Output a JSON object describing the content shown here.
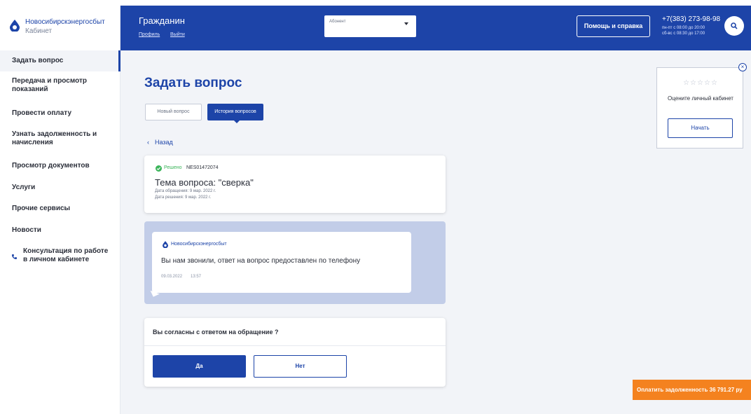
{
  "brand": {
    "name": "Новосибирскэнергосбыт",
    "subtitle": "Кабинет"
  },
  "sidebar": {
    "items": [
      {
        "label": "Задать вопрос",
        "active": true
      },
      {
        "label": "Передача и просмотр показаний"
      },
      {
        "label": "Провести оплату"
      },
      {
        "label": "Узнать задолженность и начисления"
      },
      {
        "label": "Просмотр документов"
      },
      {
        "label": "Услуги"
      },
      {
        "label": "Прочие сервисы"
      },
      {
        "label": "Новости"
      },
      {
        "label": "Консультация по работе в личном кабинете",
        "icon": "phone-icon"
      }
    ]
  },
  "header": {
    "title": "Гражданин",
    "profile_link": "Профиль",
    "logout_link": "Выйти",
    "account_select_label": "Абонент",
    "help_button": "Помощь и справка",
    "phone": "+7(383) 273-98-98",
    "hours_weekdays": "пн-пт с 08:00 до 20:00",
    "hours_weekend": "сб-вс с 08:30 до 17:00",
    "search_icon": "search-icon"
  },
  "main": {
    "page_title": "Задать вопрос",
    "tabs": [
      {
        "label": "Новый вопрос",
        "active": false
      },
      {
        "label": "История вопросов",
        "active": true
      }
    ],
    "back_label": "Назад",
    "question": {
      "status": "Решено",
      "ticket_id": "NES01472074",
      "topic": "Тема вопроса: \"сверка\"",
      "request_date": "Дата обращения: 9 мар. 2022 г.",
      "resolve_date": "Дата решения: 9 мар. 2022 г."
    },
    "message": {
      "sender": "Новосибирскэнергосбыт",
      "text": "Вы нам звонили, ответ на вопрос предоставлен по телефону",
      "date": "09.03.2022",
      "time": "13:57"
    },
    "agreement": {
      "question": "Вы согласны с ответом на обращение ?",
      "yes_label": "Да",
      "no_label": "Нет"
    },
    "rating": {
      "stars": "☆☆☆☆☆",
      "text": "Оцените личный кабинет",
      "start_label": "Начать",
      "close_icon": "close-icon"
    },
    "pay_button": "Оплатить задолженность 36 791.27 ру"
  },
  "colors": {
    "primary": "#1d44a8",
    "accent": "#f4821f",
    "success": "#3cb55b",
    "thread_bg": "#c2cde8"
  }
}
